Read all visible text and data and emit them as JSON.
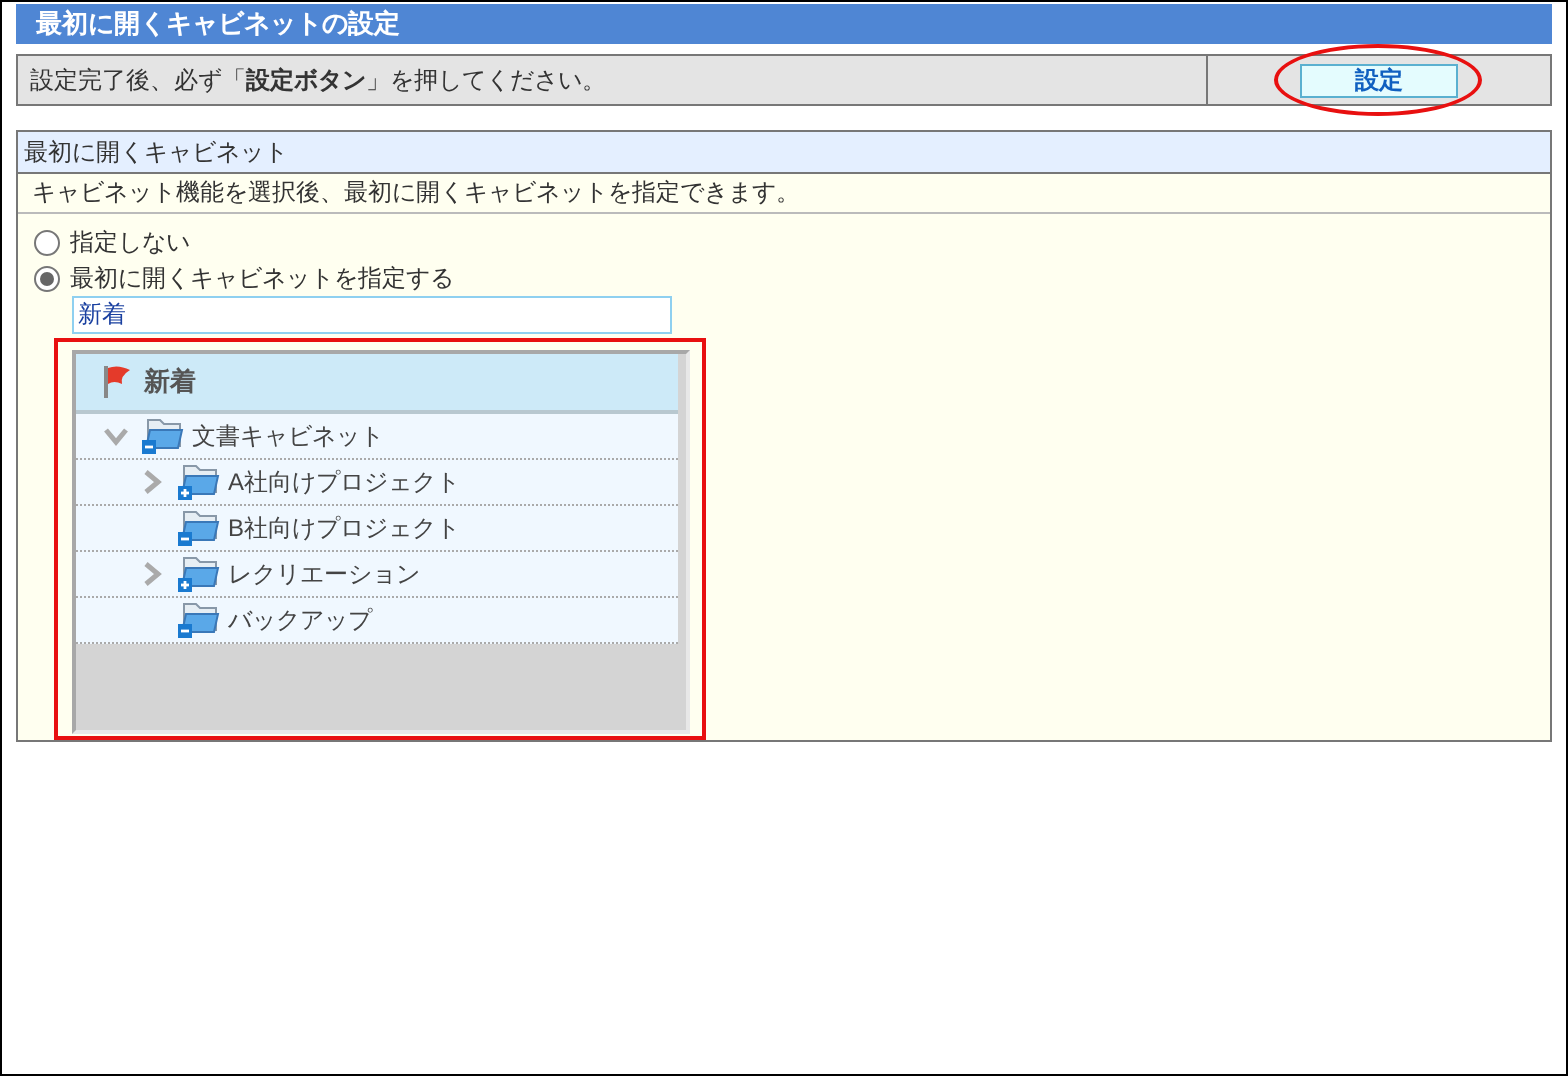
{
  "window": {
    "title": "最初に開くキャビネットの設定"
  },
  "notice": {
    "message": "設定完了後、必ず「**設定ボタン**」を押してください。",
    "button": "設定"
  },
  "section": {
    "title": "最初に開くキャビネット",
    "description": "キャビネット機能を選択後、最初に開くキャビネットを指定できます。",
    "options": [
      {
        "label": "指定しない",
        "selected": false
      },
      {
        "label": "最初に開くキャビネットを指定する",
        "selected": true
      }
    ],
    "field": {
      "value": "新着"
    },
    "tree": {
      "header": "新着",
      "items": [
        {
          "label": "文書キャビネット",
          "expanded": true,
          "children": [
            {
              "label": "A社向けプロジェクト",
              "expanded": false
            },
            {
              "label": "B社向けプロジェクト"
            },
            {
              "label": "レクリエーション",
              "expanded": false
            },
            {
              "label": "バックアップ"
            }
          ]
        }
      ]
    }
  }
}
